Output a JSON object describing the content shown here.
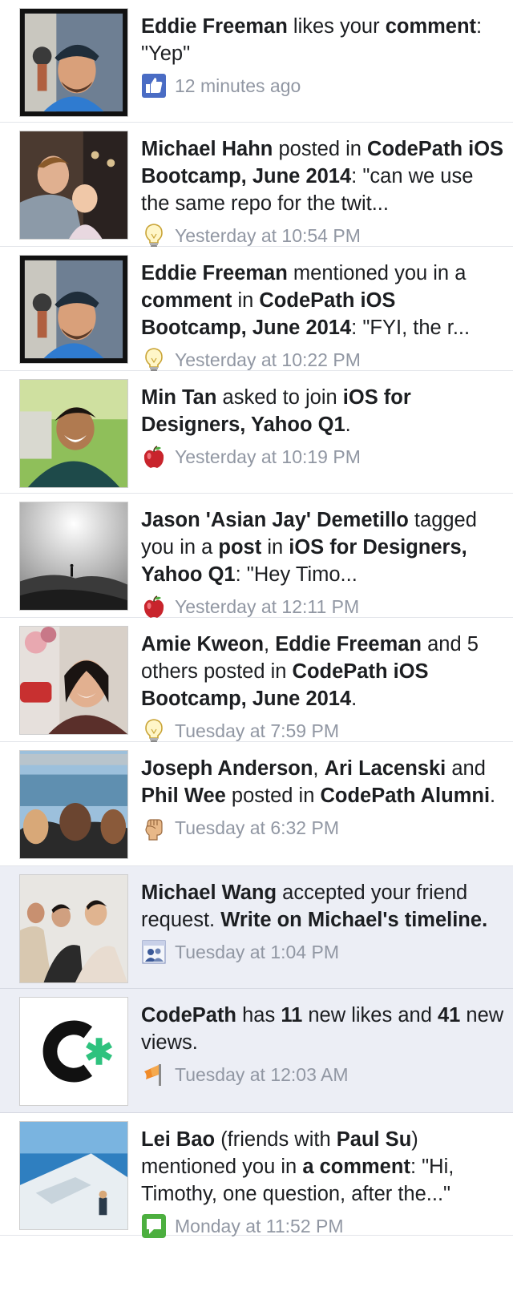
{
  "colors": {
    "unread_background": "#eceef5",
    "text": "#1c1e21",
    "timestamp": "#9197a3",
    "like_icon": "#4a6cc4",
    "comment_icon": "#4caf3f",
    "codepath_asterisk": "#2ec27e"
  },
  "notifications": [
    {
      "unread": false,
      "avatar": "eddie-freeman-photo",
      "icon": "like-icon",
      "parts": [
        {
          "b": true,
          "t": "Eddie Freeman"
        },
        {
          "t": " likes your "
        },
        {
          "b": true,
          "t": "comment"
        },
        {
          "t": ": \"Yep\""
        }
      ],
      "time": "12 minutes ago"
    },
    {
      "unread": false,
      "avatar": "michael-hahn-photo",
      "icon": "lightbulb-icon",
      "parts": [
        {
          "b": true,
          "t": "Michael Hahn"
        },
        {
          "t": " posted in "
        },
        {
          "b": true,
          "t": "CodePath iOS Bootcamp, June 2014"
        },
        {
          "t": ": \"can we use the same repo for the twit..."
        }
      ],
      "time": "Yesterday at 10:54 PM"
    },
    {
      "unread": false,
      "avatar": "eddie-freeman-photo",
      "icon": "lightbulb-icon",
      "parts": [
        {
          "b": true,
          "t": "Eddie Freeman"
        },
        {
          "t": " mentioned you in a "
        },
        {
          "b": true,
          "t": "comment"
        },
        {
          "t": " in "
        },
        {
          "b": true,
          "t": "CodePath iOS Bootcamp, June 2014"
        },
        {
          "t": ": \"FYI, the r..."
        }
      ],
      "time": "Yesterday at 10:22 PM"
    },
    {
      "unread": false,
      "avatar": "min-tan-photo",
      "icon": "apple-icon",
      "parts": [
        {
          "b": true,
          "t": "Min Tan"
        },
        {
          "t": " asked to join "
        },
        {
          "b": true,
          "t": "iOS for Designers, Yahoo Q1"
        },
        {
          "t": "."
        }
      ],
      "time": "Yesterday at 10:19 PM"
    },
    {
      "unread": false,
      "avatar": "jason-demetillo-photo",
      "icon": "apple-icon",
      "parts": [
        {
          "b": true,
          "t": "Jason 'Asian Jay' Demetillo"
        },
        {
          "t": " tagged you in a "
        },
        {
          "b": true,
          "t": "post"
        },
        {
          "t": " in "
        },
        {
          "b": true,
          "t": "iOS for Designers, Yahoo Q1"
        },
        {
          "t": ": \"Hey Timo..."
        }
      ],
      "time": "Yesterday at 12:11 PM"
    },
    {
      "unread": false,
      "avatar": "amie-kweon-photo",
      "icon": "lightbulb-icon",
      "parts": [
        {
          "b": true,
          "t": "Amie Kweon"
        },
        {
          "t": ", "
        },
        {
          "b": true,
          "t": "Eddie Freeman"
        },
        {
          "t": " and 5 others posted in "
        },
        {
          "b": true,
          "t": "CodePath iOS Bootcamp, June 2014"
        },
        {
          "t": "."
        }
      ],
      "time": "Tuesday at 7:59 PM"
    },
    {
      "unread": false,
      "avatar": "joseph-anderson-photo",
      "icon": "fist-icon",
      "parts": [
        {
          "b": true,
          "t": "Joseph Anderson"
        },
        {
          "t": ", "
        },
        {
          "b": true,
          "t": "Ari Lacenski"
        },
        {
          "t": " and "
        },
        {
          "b": true,
          "t": "Phil Wee"
        },
        {
          "t": " posted in "
        },
        {
          "b": true,
          "t": "CodePath Alumni"
        },
        {
          "t": "."
        }
      ],
      "time": "Tuesday at 6:32 PM"
    },
    {
      "unread": true,
      "avatar": "michael-wang-photo",
      "icon": "friends-icon",
      "parts": [
        {
          "b": true,
          "t": "Michael Wang"
        },
        {
          "t": " accepted your friend request. "
        },
        {
          "b": true,
          "t": "Write on Michael's timeline."
        }
      ],
      "time": "Tuesday at 1:04 PM"
    },
    {
      "unread": true,
      "avatar": "codepath-logo",
      "icon": "flag-icon",
      "parts": [
        {
          "b": true,
          "t": "CodePath"
        },
        {
          "t": " has "
        },
        {
          "b": true,
          "t": "11"
        },
        {
          "t": " new likes and "
        },
        {
          "b": true,
          "t": "41"
        },
        {
          "t": " new views."
        }
      ],
      "time": "Tuesday at 12:03 AM"
    },
    {
      "unread": false,
      "avatar": "lei-bao-photo",
      "icon": "comment-icon",
      "parts": [
        {
          "b": true,
          "t": "Lei Bao"
        },
        {
          "t": " (friends with "
        },
        {
          "b": true,
          "t": "Paul Su"
        },
        {
          "t": ") mentioned you in "
        },
        {
          "b": true,
          "t": "a comment"
        },
        {
          "t": ": \"Hi, Timothy, one question, after the...\""
        }
      ],
      "time": "Monday at 11:52 PM"
    }
  ]
}
